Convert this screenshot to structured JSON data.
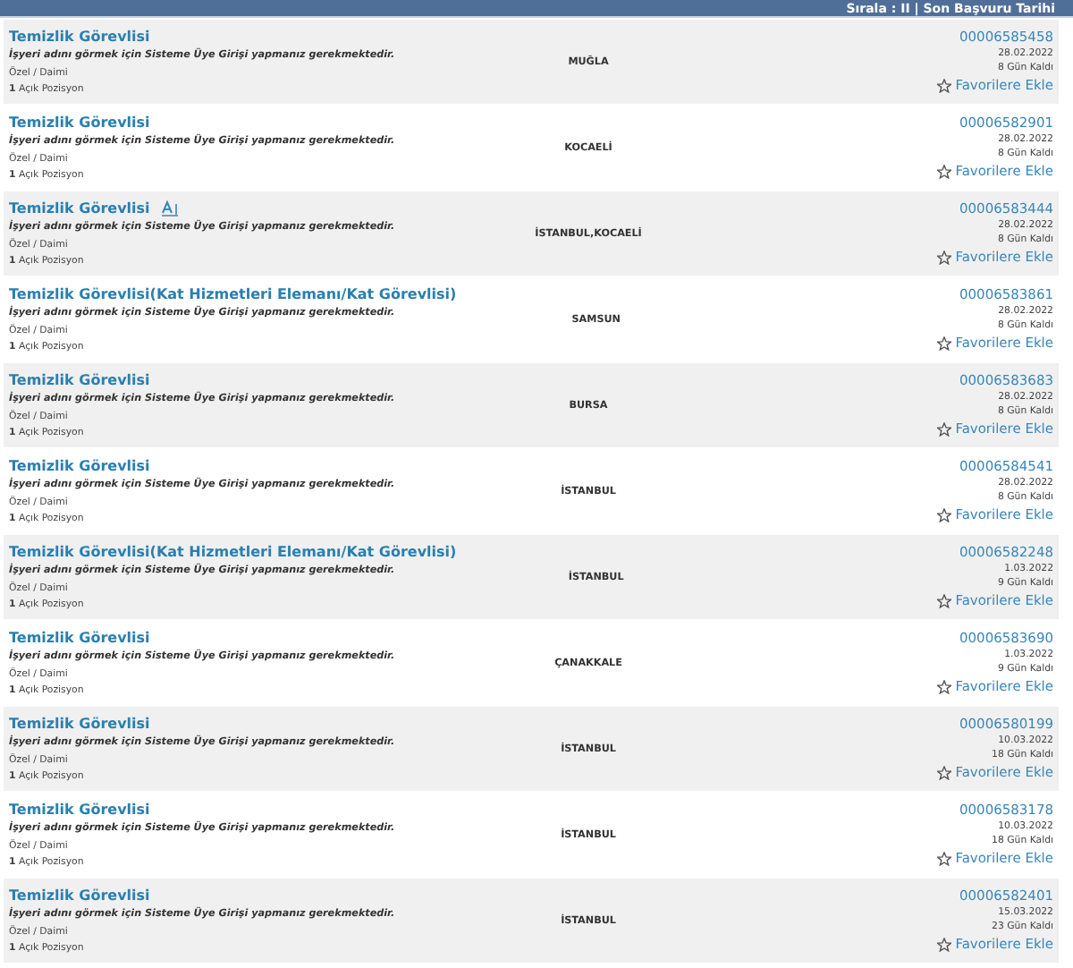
{
  "header": {
    "sort_label": "Sırala : II | Son Başvuru Tarihi"
  },
  "jobs": [
    {
      "title": "Temizlik Görevlisi",
      "badge": false,
      "notice": "İşyeri adını görmek için Sisteme Üye Girişi yapmanız gerekmektedir.",
      "type": "Özel / Daimi",
      "positions": "**1** Açık Pozisyon",
      "location": "MUĞLA",
      "code": "00006585458",
      "date": "28.02.2022",
      "remaining": "8 Gün Kaldı",
      "favorite": "Favorilere Ekle"
    },
    {
      "title": "Temizlik Görevlisi",
      "badge": false,
      "notice": "İşyeri adını görmek için Sisteme Üye Girişi yapmanız gerekmektedir.",
      "type": "Özel / Daimi",
      "positions": "**1** Açık Pozisyon",
      "location": "KOCAELİ",
      "code": "00006582901",
      "date": "28.02.2022",
      "remaining": "8 Gün Kaldı",
      "favorite": "Favorilere Ekle"
    },
    {
      "title": "Temizlik Görevlisi",
      "badge": true,
      "notice": "İşyeri adını görmek için Sisteme Üye Girişi yapmanız gerekmektedir.",
      "type": "Özel / Daimi",
      "positions": "**1** Açık Pozisyon",
      "location": "İSTANBUL,KOCAELİ",
      "code": "00006583444",
      "date": "28.02.2022",
      "remaining": "8 Gün Kaldı",
      "favorite": "Favorilere Ekle"
    },
    {
      "title": "Temizlik Görevlisi(Kat Hizmetleri Elemanı/Kat Görevlisi)",
      "badge": false,
      "notice": "İşyeri adını görmek için Sisteme Üye Girişi yapmanız gerekmektedir.",
      "type": "Özel / Daimi",
      "positions": "**1** Açık Pozisyon",
      "location": "SAMSUN",
      "code": "00006583861",
      "date": "28.02.2022",
      "remaining": "8 Gün Kaldı",
      "favorite": "Favorilere Ekle"
    },
    {
      "title": "Temizlik Görevlisi",
      "badge": false,
      "notice": "İşyeri adını görmek için Sisteme Üye Girişi yapmanız gerekmektedir.",
      "type": "Özel / Daimi",
      "positions": "**1** Açık Pozisyon",
      "location": "BURSA",
      "code": "00006583683",
      "date": "28.02.2022",
      "remaining": "8 Gün Kaldı",
      "favorite": "Favorilere Ekle"
    },
    {
      "title": "Temizlik Görevlisi",
      "badge": false,
      "notice": "İşyeri adını görmek için Sisteme Üye Girişi yapmanız gerekmektedir.",
      "type": "Özel / Daimi",
      "positions": "**1** Açık Pozisyon",
      "location": "İSTANBUL",
      "code": "00006584541",
      "date": "28.02.2022",
      "remaining": "8 Gün Kaldı",
      "favorite": "Favorilere Ekle"
    },
    {
      "title": "Temizlik Görevlisi(Kat Hizmetleri Elemanı/Kat Görevlisi)",
      "badge": false,
      "notice": "İşyeri adını görmek için Sisteme Üye Girişi yapmanız gerekmektedir.",
      "type": "Özel / Daimi",
      "positions": "**1** Açık Pozisyon",
      "location": "İSTANBUL",
      "code": "00006582248",
      "date": "1.03.2022",
      "remaining": "9 Gün Kaldı",
      "favorite": "Favorilere Ekle"
    },
    {
      "title": "Temizlik Görevlisi",
      "badge": false,
      "notice": "İşyeri adını görmek için Sisteme Üye Girişi yapmanız gerekmektedir.",
      "type": "Özel / Daimi",
      "positions": "**1** Açık Pozisyon",
      "location": "ÇANAKKALE",
      "code": "00006583690",
      "date": "1.03.2022",
      "remaining": "9 Gün Kaldı",
      "favorite": "Favorilere Ekle"
    },
    {
      "title": "Temizlik Görevlisi",
      "badge": false,
      "notice": "İşyeri adını görmek için Sisteme Üye Girişi yapmanız gerekmektedir.",
      "type": "Özel / Daimi",
      "positions": "**1** Açık Pozisyon",
      "location": "İSTANBUL",
      "code": "00006580199",
      "date": "10.03.2022",
      "remaining": "18 Gün Kaldı",
      "favorite": "Favorilere Ekle"
    },
    {
      "title": "Temizlik Görevlisi",
      "badge": false,
      "notice": "İşyeri adını görmek için Sisteme Üye Girişi yapmanız gerekmektedir.",
      "type": "Özel / Daimi",
      "positions": "**1** Açık Pozisyon",
      "location": "İSTANBUL",
      "code": "00006583178",
      "date": "10.03.2022",
      "remaining": "18 Gün Kaldı",
      "favorite": "Favorilere Ekle"
    },
    {
      "title": "Temizlik Görevlisi",
      "badge": false,
      "notice": "İşyeri adını görmek için Sisteme Üye Girişi yapmanız gerekmektedir.",
      "type": "Özel / Daimi",
      "positions": "**1** Açık Pozisyon",
      "location": "İSTANBUL",
      "code": "00006582401",
      "date": "15.03.2022",
      "remaining": "23 Gün Kaldı",
      "favorite": "Favorilere Ekle"
    }
  ]
}
